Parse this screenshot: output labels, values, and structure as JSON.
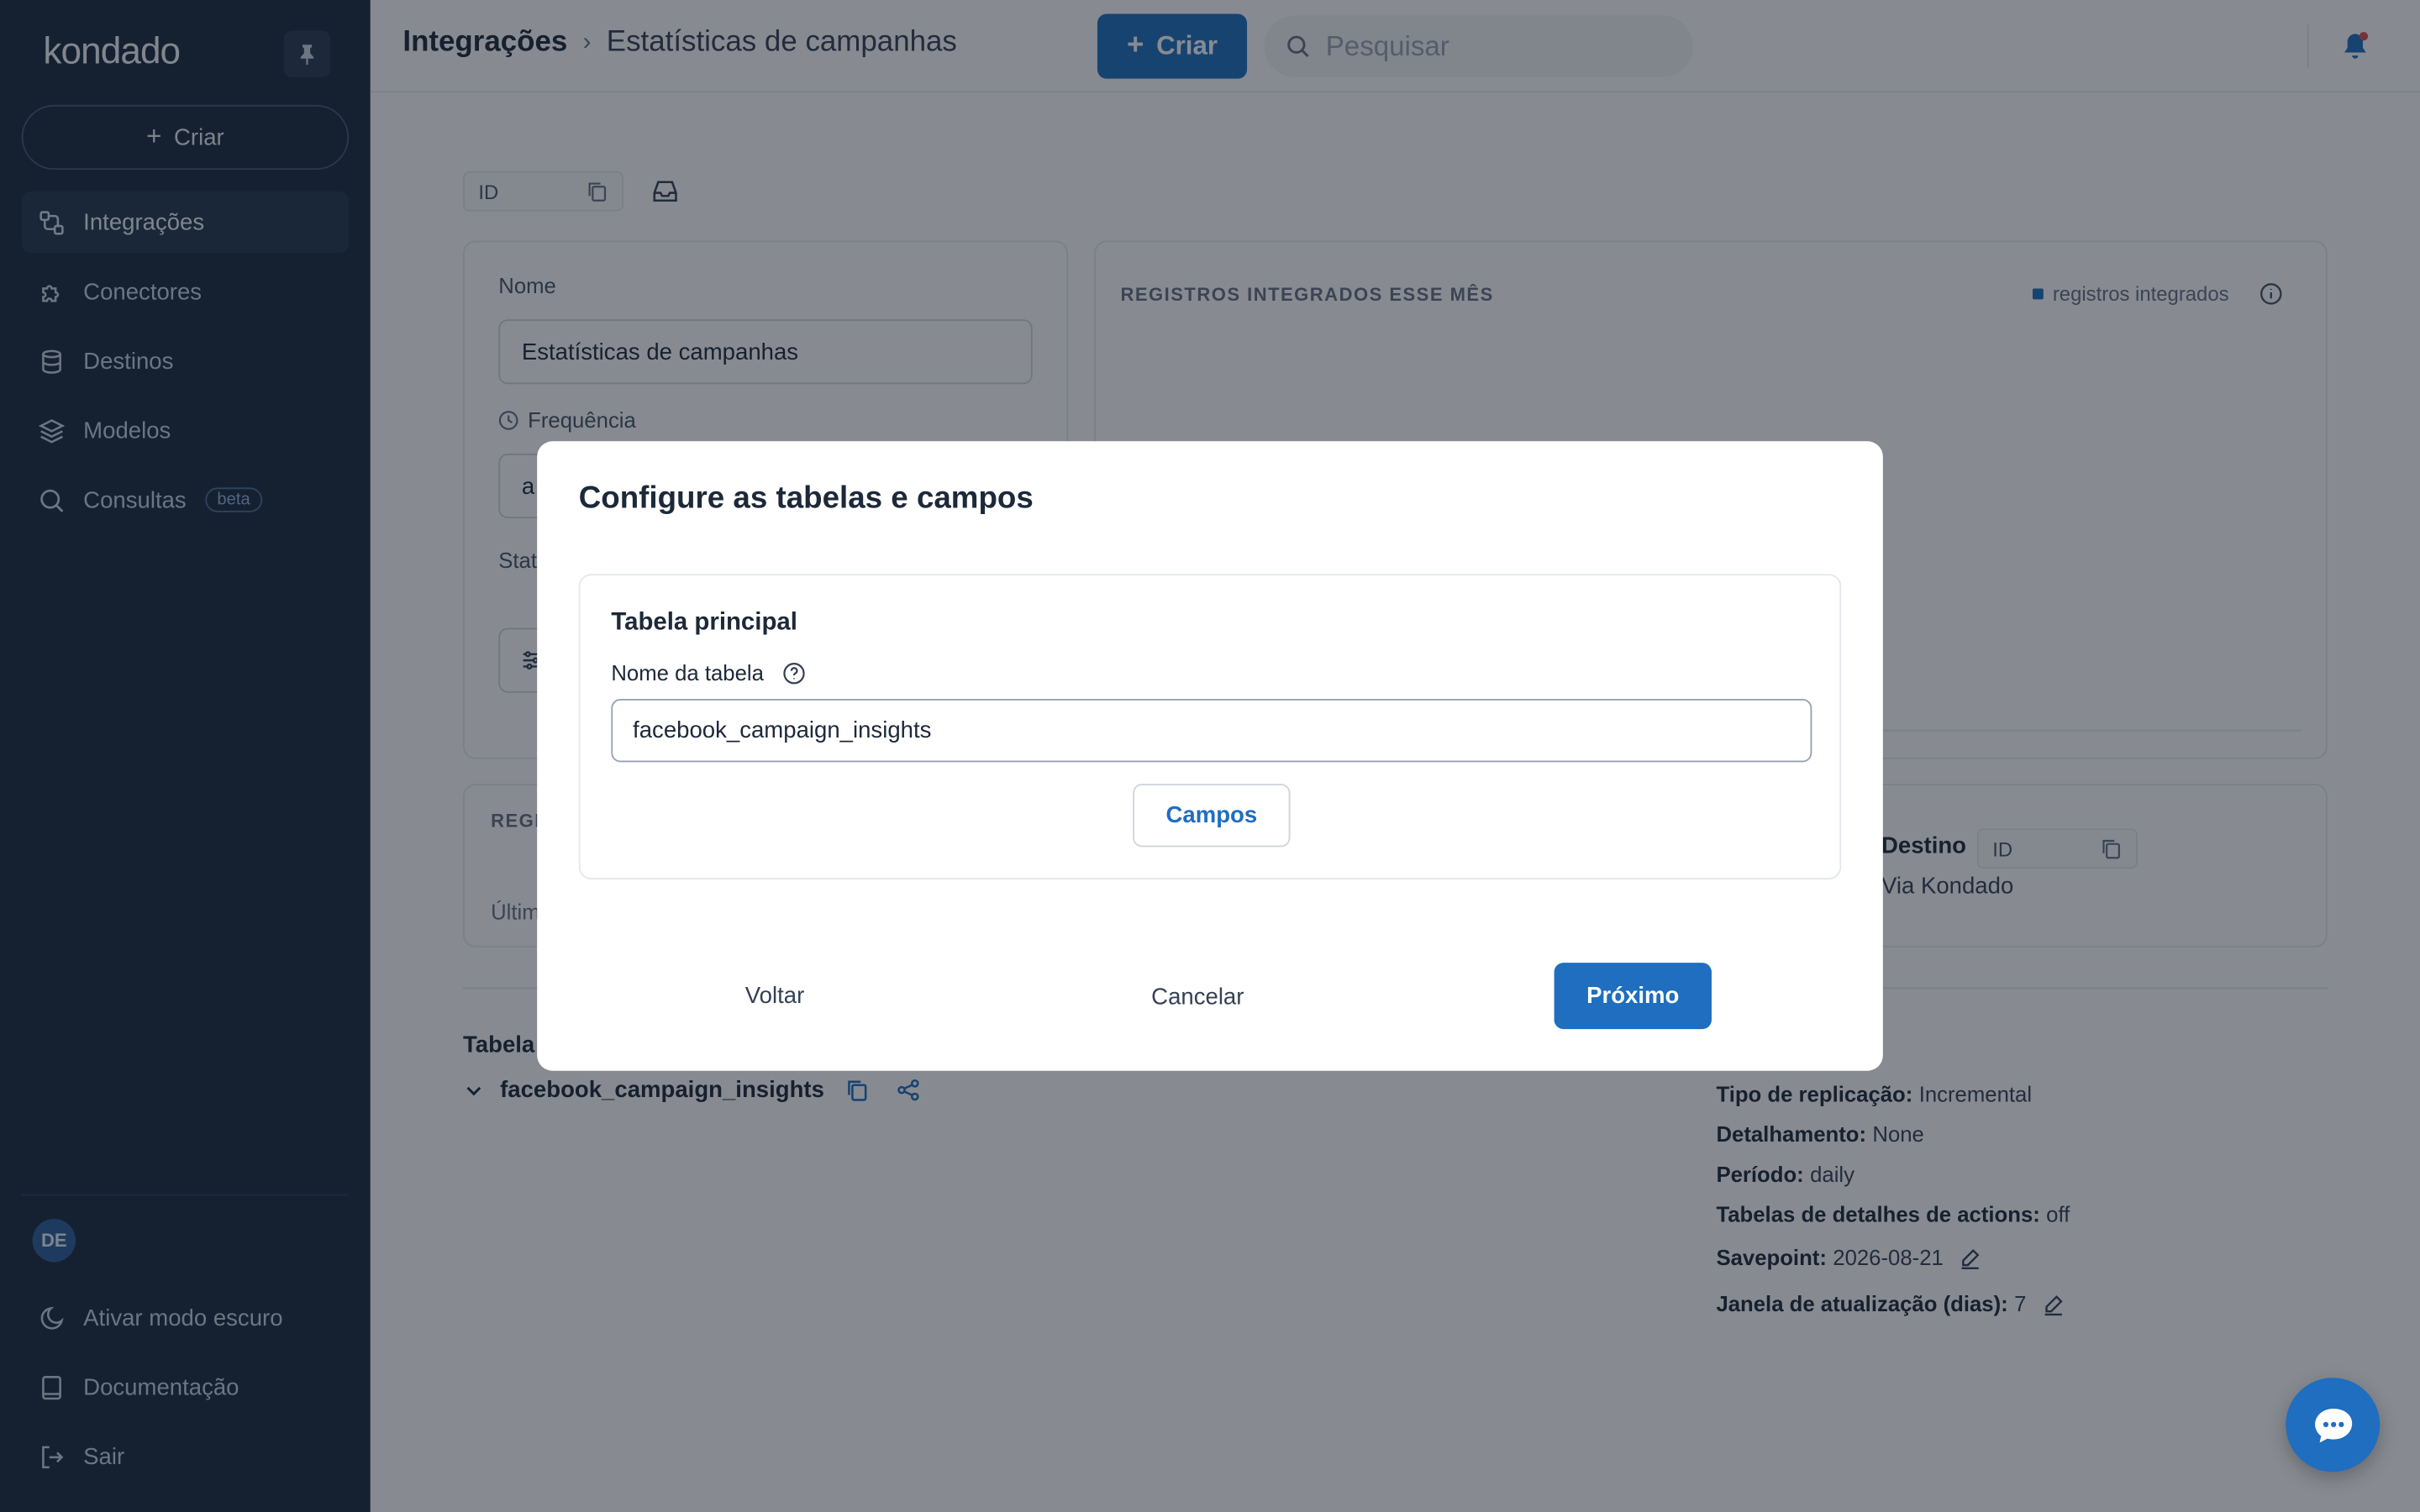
{
  "app": {
    "logo": "kondado"
  },
  "sidebar": {
    "create_label": "Criar",
    "items": [
      {
        "label": "Integrações",
        "icon": "integrations-icon",
        "active": true
      },
      {
        "label": "Conectores",
        "icon": "puzzle-icon"
      },
      {
        "label": "Destinos",
        "icon": "database-icon"
      },
      {
        "label": "Modelos",
        "icon": "layers-icon"
      },
      {
        "label": "Consultas",
        "icon": "search-icon",
        "badge": "beta"
      }
    ],
    "avatar_initials": "DE",
    "bottom_items": [
      {
        "label": "Ativar modo escuro",
        "icon": "moon-icon"
      },
      {
        "label": "Documentação",
        "icon": "book-icon"
      },
      {
        "label": "Sair",
        "icon": "logout-icon"
      }
    ]
  },
  "header": {
    "breadcrumb": [
      "Integrações",
      "Estatísticas de campanhas"
    ],
    "create_label": "Criar",
    "search_placeholder": "Pesquisar"
  },
  "page": {
    "id_label": "ID",
    "name_label": "Nome",
    "name_value": "Estatísticas de campanhas",
    "frequency_label": "Frequência",
    "frequency_value": "a",
    "status_label": "Stat",
    "chart_title": "REGISTROS INTEGRADOS ESSE MÊS",
    "chart_legend": "registros integrados",
    "regi_label": "REGI",
    "last_label": "Últim",
    "destino_label": "Destino",
    "destino_id": "ID",
    "destino_via": "Via Kondado",
    "tables_label": "Tabela",
    "table_name": "facebook_campaign_insights",
    "replication": [
      {
        "key": "Tipo de replicação:",
        "value": "Incremental"
      },
      {
        "key": "Detalhamento:",
        "value": "None"
      },
      {
        "key": "Período:",
        "value": "daily"
      },
      {
        "key": "Tabelas de detalhes de actions:",
        "value": "off"
      },
      {
        "key": "Savepoint:",
        "value": "2026-08-21",
        "editable": true
      },
      {
        "key": "Janela de atualização (dias):",
        "value": "7",
        "editable": true
      }
    ]
  },
  "modal": {
    "title": "Configure as tabelas e campos",
    "section_title": "Tabela principal",
    "field_label": "Nome da tabela",
    "field_value": "facebook_campaign_insights",
    "campos_label": "Campos",
    "back_label": "Voltar",
    "cancel_label": "Cancelar",
    "next_label": "Próximo"
  },
  "colors": {
    "sidebar_bg": "#1b2a3e",
    "primary": "#1f6ebf",
    "notification_dot": "#e5484d"
  }
}
